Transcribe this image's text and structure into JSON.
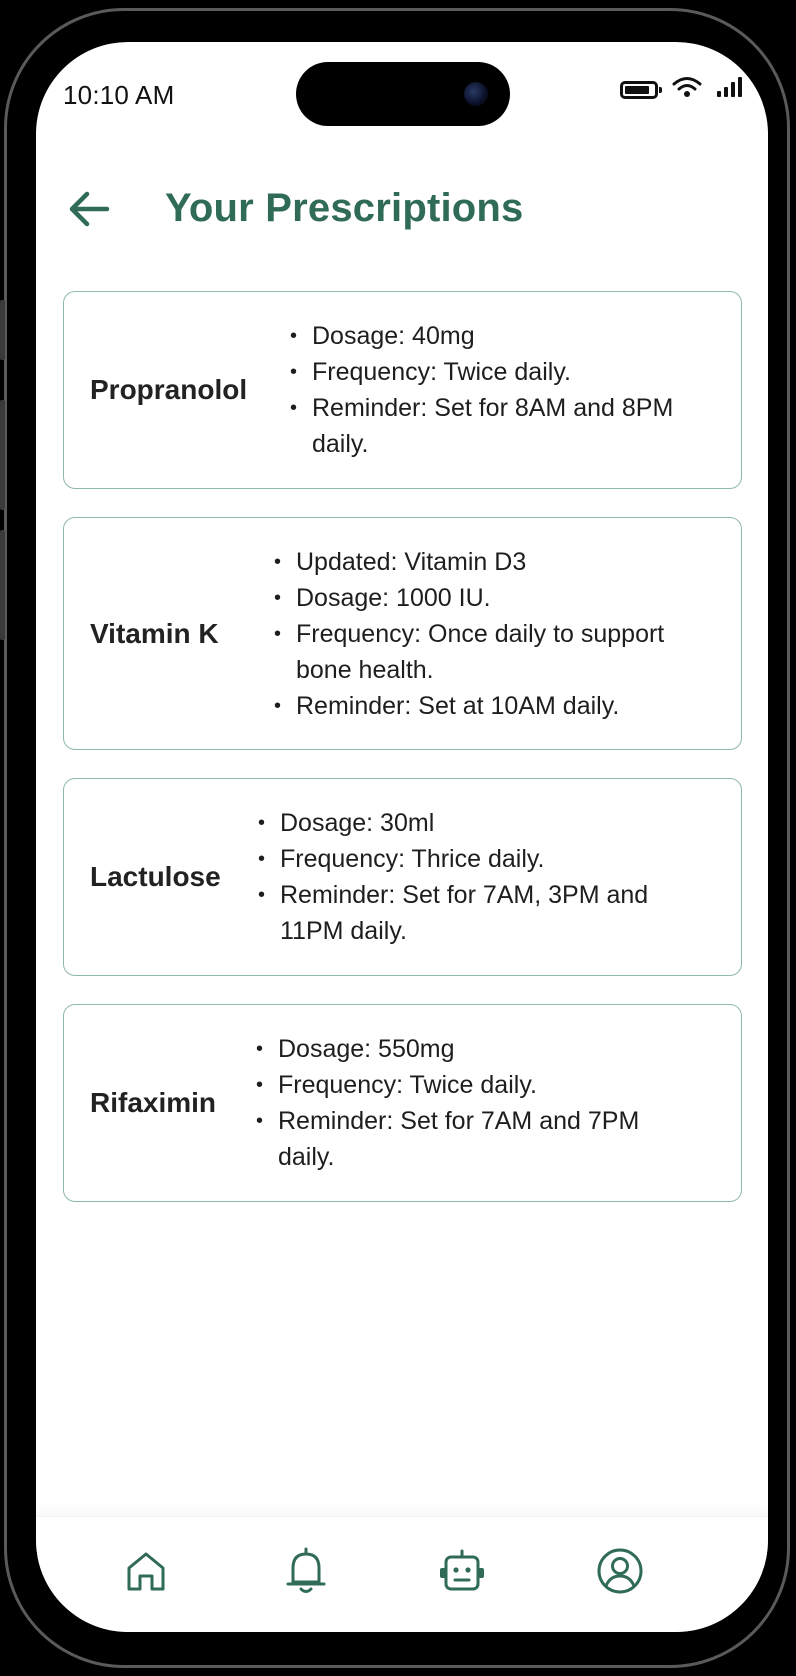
{
  "status_bar": {
    "time": "10:10 AM"
  },
  "header": {
    "title": "Your Prescriptions",
    "back_icon": "arrow-left-icon"
  },
  "colors": {
    "accent": "#2f6b57",
    "card_border": "#8fb8a8",
    "text": "#1e1e1e"
  },
  "prescriptions": [
    {
      "name": "Propranolol",
      "details": [
        "Dosage: 40mg",
        "Frequency: Twice daily.",
        "Reminder: Set for 8AM and 8PM daily."
      ]
    },
    {
      "name": "Vitamin K",
      "details": [
        "Updated: Vitamin D3",
        "Dosage: 1000 IU.",
        "Frequency: Once daily to support bone health.",
        "Reminder: Set at 10AM daily."
      ]
    },
    {
      "name": "Lactulose",
      "details": [
        "Dosage: 30ml",
        "Frequency: Thrice daily.",
        "Reminder: Set for 7AM, 3PM and 11PM daily."
      ]
    },
    {
      "name": "Rifaximin",
      "details": [
        "Dosage: 550mg",
        "Frequency: Twice daily.",
        "Reminder: Set for 7AM and 7PM daily."
      ]
    }
  ],
  "bottom_nav": {
    "items": [
      "home-icon",
      "bell-icon",
      "robot-icon",
      "profile-icon"
    ]
  }
}
